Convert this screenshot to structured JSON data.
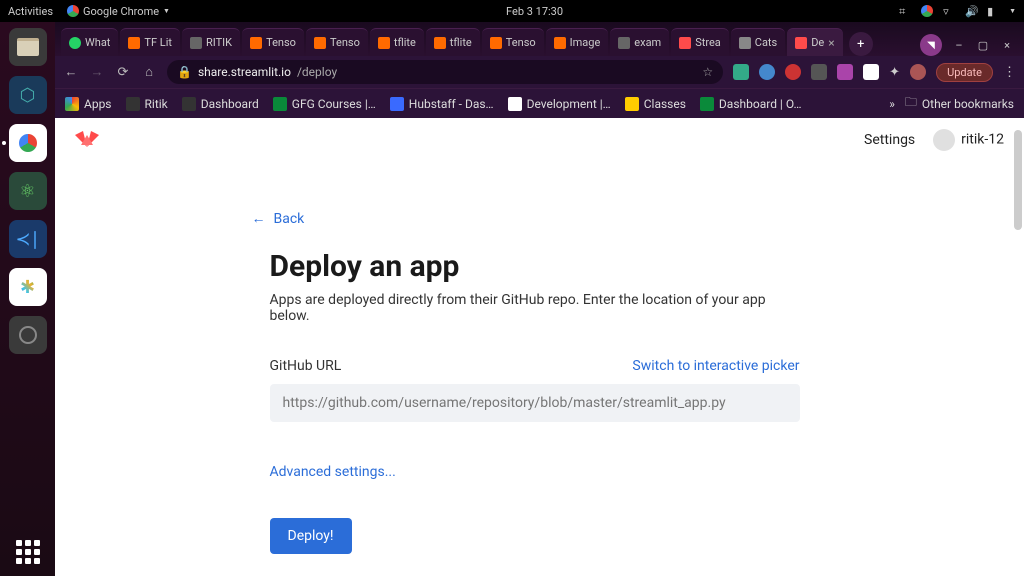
{
  "gnome": {
    "activities": "Activities",
    "app_label": "Google Chrome",
    "datetime": "Feb 3  17:30"
  },
  "tabs": [
    {
      "label": "What",
      "fav": "#25d366"
    },
    {
      "label": "TF Lit",
      "fav": "#ff6a00"
    },
    {
      "label": "RITIK",
      "fav": "#666"
    },
    {
      "label": "Tenso",
      "fav": "#ff6a00"
    },
    {
      "label": "Tenso",
      "fav": "#ff6a00"
    },
    {
      "label": "tflite",
      "fav": "#ff6a00"
    },
    {
      "label": "tflite",
      "fav": "#ff6a00"
    },
    {
      "label": "Tenso",
      "fav": "#ff6a00"
    },
    {
      "label": "Image",
      "fav": "#ff6a00"
    },
    {
      "label": "exam",
      "fav": "#666"
    },
    {
      "label": "Strea",
      "fav": "#ff4b4b"
    },
    {
      "label": "Cats",
      "fav": "#888"
    },
    {
      "label": "De",
      "fav": "#ff4b4b"
    }
  ],
  "url": {
    "host": "share.streamlit.io",
    "path": "/deploy"
  },
  "update_label": "Update",
  "bookmarks": [
    {
      "label": "Apps",
      "fav": "#4285f4"
    },
    {
      "label": "Ritik",
      "fav": "#333"
    },
    {
      "label": "Dashboard",
      "fav": "#333"
    },
    {
      "label": "GFG Courses |…",
      "fav": "#0a8a3a"
    },
    {
      "label": "Hubstaff - Das…",
      "fav": "#3a6aff"
    },
    {
      "label": "Development |…",
      "fav": "#333"
    },
    {
      "label": "Classes",
      "fav": "#ffcc00"
    },
    {
      "label": "Dashboard | O…",
      "fav": "#0a8a3a"
    }
  ],
  "other_bookmarks": "Other bookmarks",
  "page": {
    "settings": "Settings",
    "username": "ritik-12",
    "back": "Back",
    "title": "Deploy an app",
    "subtitle": "Apps are deployed directly from their GitHub repo. Enter the location of your app below.",
    "url_label": "GitHub URL",
    "switch_label": "Switch to interactive picker",
    "url_placeholder": "https://github.com/username/repository/blob/master/streamlit_app.py",
    "advanced": "Advanced settings...",
    "deploy": "Deploy!"
  }
}
